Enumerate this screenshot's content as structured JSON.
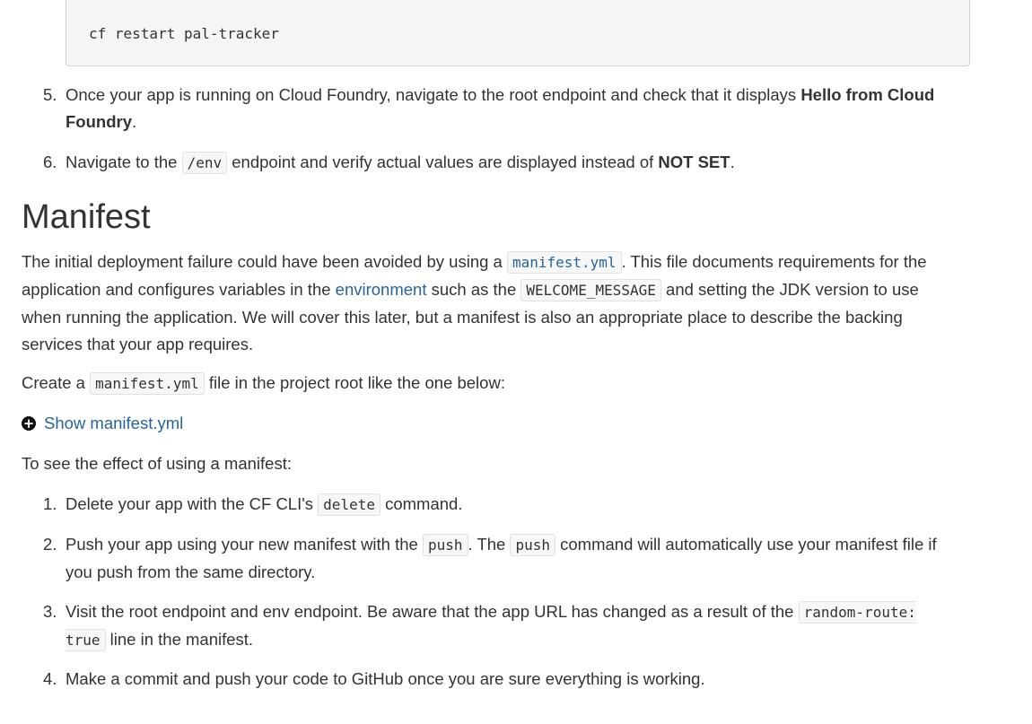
{
  "code_block": {
    "text": "cf restart pal-tracker"
  },
  "list_a": [
    {
      "number": "5.",
      "before": "Once your app is running on Cloud Foundry, navigate to the root endpoint and check that it displays ",
      "strong": "Hello from Cloud Foundry",
      "after": "."
    },
    {
      "number": "6.",
      "before": "Navigate to the ",
      "code": "/env",
      "middle": " endpoint and verify actual values are displayed instead of ",
      "strong": "NOT SET",
      "after": "."
    }
  ],
  "manifest_section": {
    "heading": "Manifest",
    "intro": {
      "t1": "The initial deployment failure could have been avoided by using a ",
      "code1": "manifest.yml",
      "t2": ". This file documents requirements for the application and configures variables in the ",
      "link": "environment",
      "t3": " such as the ",
      "code2": "WELCOME_MESSAGE",
      "t4": " and setting the JDK version to use when running the application. We will cover this later, but a manifest is also an appropriate place to describe the backing services that your app requires."
    },
    "create": {
      "t1": "Create a ",
      "code": "manifest.yml",
      "t2": " file in the project root like the one below:"
    },
    "toggle_label": "Show manifest.yml",
    "effect_intro": "To see the effect of using a manifest:"
  },
  "list_b": [
    {
      "number": "1.",
      "t1": "Delete your app with the CF CLI's ",
      "code": "delete",
      "t2": " command."
    },
    {
      "number": "2.",
      "t1": "Push your app using your new manifest with the ",
      "code1": "push",
      "t2": ". The ",
      "code2": "push",
      "t3": " command will automatically use your manifest file if you push from the same directory."
    },
    {
      "number": "3.",
      "t1": "Visit the root endpoint and env endpoint. Be aware that the app URL has changed as a result of the ",
      "code1": "random-route:",
      "code2": "true",
      "t2": " line in the manifest."
    },
    {
      "number": "4.",
      "t1": "Make a commit and push your code to GitHub once you are sure everything is working."
    }
  ]
}
